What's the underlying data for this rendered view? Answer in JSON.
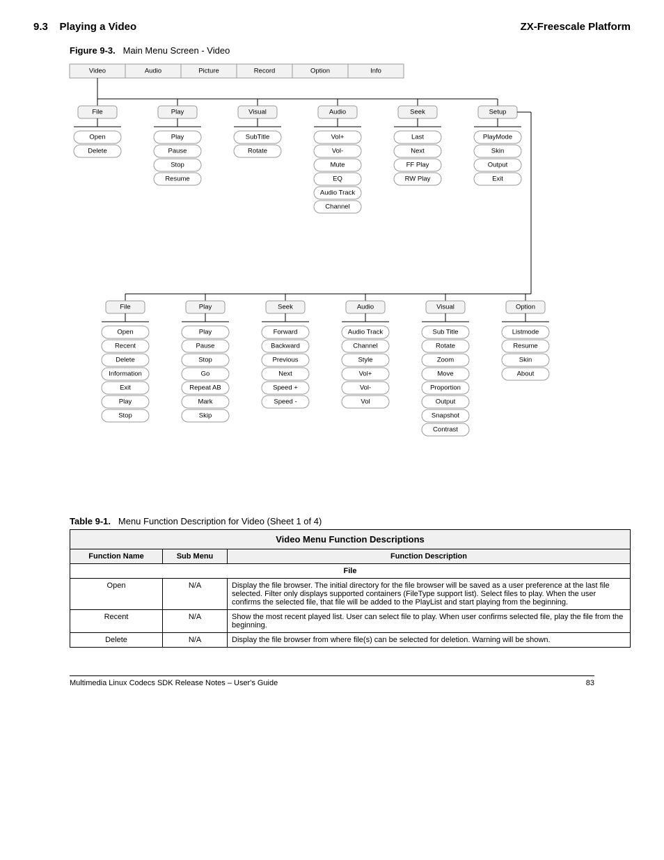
{
  "header": {
    "section": "9.3",
    "title": "Playing a Video",
    "product": "ZX-Freescale Platform"
  },
  "figure": {
    "label": "Figure 9-3.",
    "title": "Main Menu Screen - Video",
    "tabs": [
      "Video",
      "Audio",
      "Picture",
      "Record",
      "Option",
      "Info"
    ],
    "top_groups": [
      {
        "head": "File",
        "items": [
          "Open",
          "Delete"
        ]
      },
      {
        "head": "Play",
        "items": [
          "Play",
          "Pause",
          "Stop",
          "Resume"
        ]
      },
      {
        "head": "Visual",
        "items": [
          "SubTitle",
          "Rotate"
        ]
      },
      {
        "head": "Audio",
        "items": [
          "Vol+",
          "Vol-",
          "Mute",
          "EQ",
          "Audio Track",
          "Channel"
        ]
      },
      {
        "head": "Seek",
        "items": [
          "Last",
          "Next",
          "FF Play",
          "RW Play"
        ]
      },
      {
        "head": "Setup",
        "items": [
          "PlayMode",
          "Skin",
          "Output",
          "Exit"
        ]
      }
    ],
    "bottom_groups": [
      {
        "head": "File",
        "items": [
          "Open",
          "Recent",
          "Delete",
          "Information",
          "Exit",
          "Play",
          "Stop"
        ]
      },
      {
        "head": "Play",
        "items": [
          "Play",
          "Pause",
          "Stop",
          "Go",
          "Repeat AB",
          "Mark",
          "Skip"
        ]
      },
      {
        "head": "Seek",
        "items": [
          "Forward",
          "Backward",
          "Previous",
          "Next",
          "Speed +",
          "Speed -"
        ]
      },
      {
        "head": "Audio",
        "items": [
          "Audio Track",
          "Channel",
          "Style",
          "Vol+",
          "Vol-",
          "Vol"
        ]
      },
      {
        "head": "Visual",
        "items": [
          "Sub Title",
          "Rotate",
          "Zoom",
          "Move",
          "Proportion",
          "Output",
          "Snapshot",
          "Contrast"
        ]
      },
      {
        "head": "Option",
        "items": [
          "Listmode",
          "Resume",
          "Skin",
          "About"
        ]
      }
    ]
  },
  "table": {
    "caption_label": "Table 9-1.",
    "caption_title": "Menu Function Description for Video (Sheet 1 of 4)",
    "title": "Video Menu Function Descriptions",
    "cols": [
      "Function Name",
      "Sub Menu",
      "Function Description"
    ],
    "section0": "File",
    "rows": [
      {
        "name": "Open",
        "sub": "N/A",
        "desc": "Display the file browser. The initial directory for the file browser will be saved as a user preference at the last file selected. Filter only displays supported containers (FileType support list). Select files to play. When the user confirms the selected file, that file will be added to the PlayList and start playing from the beginning."
      },
      {
        "name": "Recent",
        "sub": "N/A",
        "desc": "Show the most recent played list. User can select file to play. When user confirms selected file, play the file from the beginning."
      },
      {
        "name": "Delete",
        "sub": "N/A",
        "desc": "Display the file browser from where file(s) can be selected for deletion. Warning will be shown."
      }
    ]
  },
  "footer": {
    "left": "Multimedia Linux Codecs SDK Release Notes – User's Guide",
    "right": "83"
  }
}
